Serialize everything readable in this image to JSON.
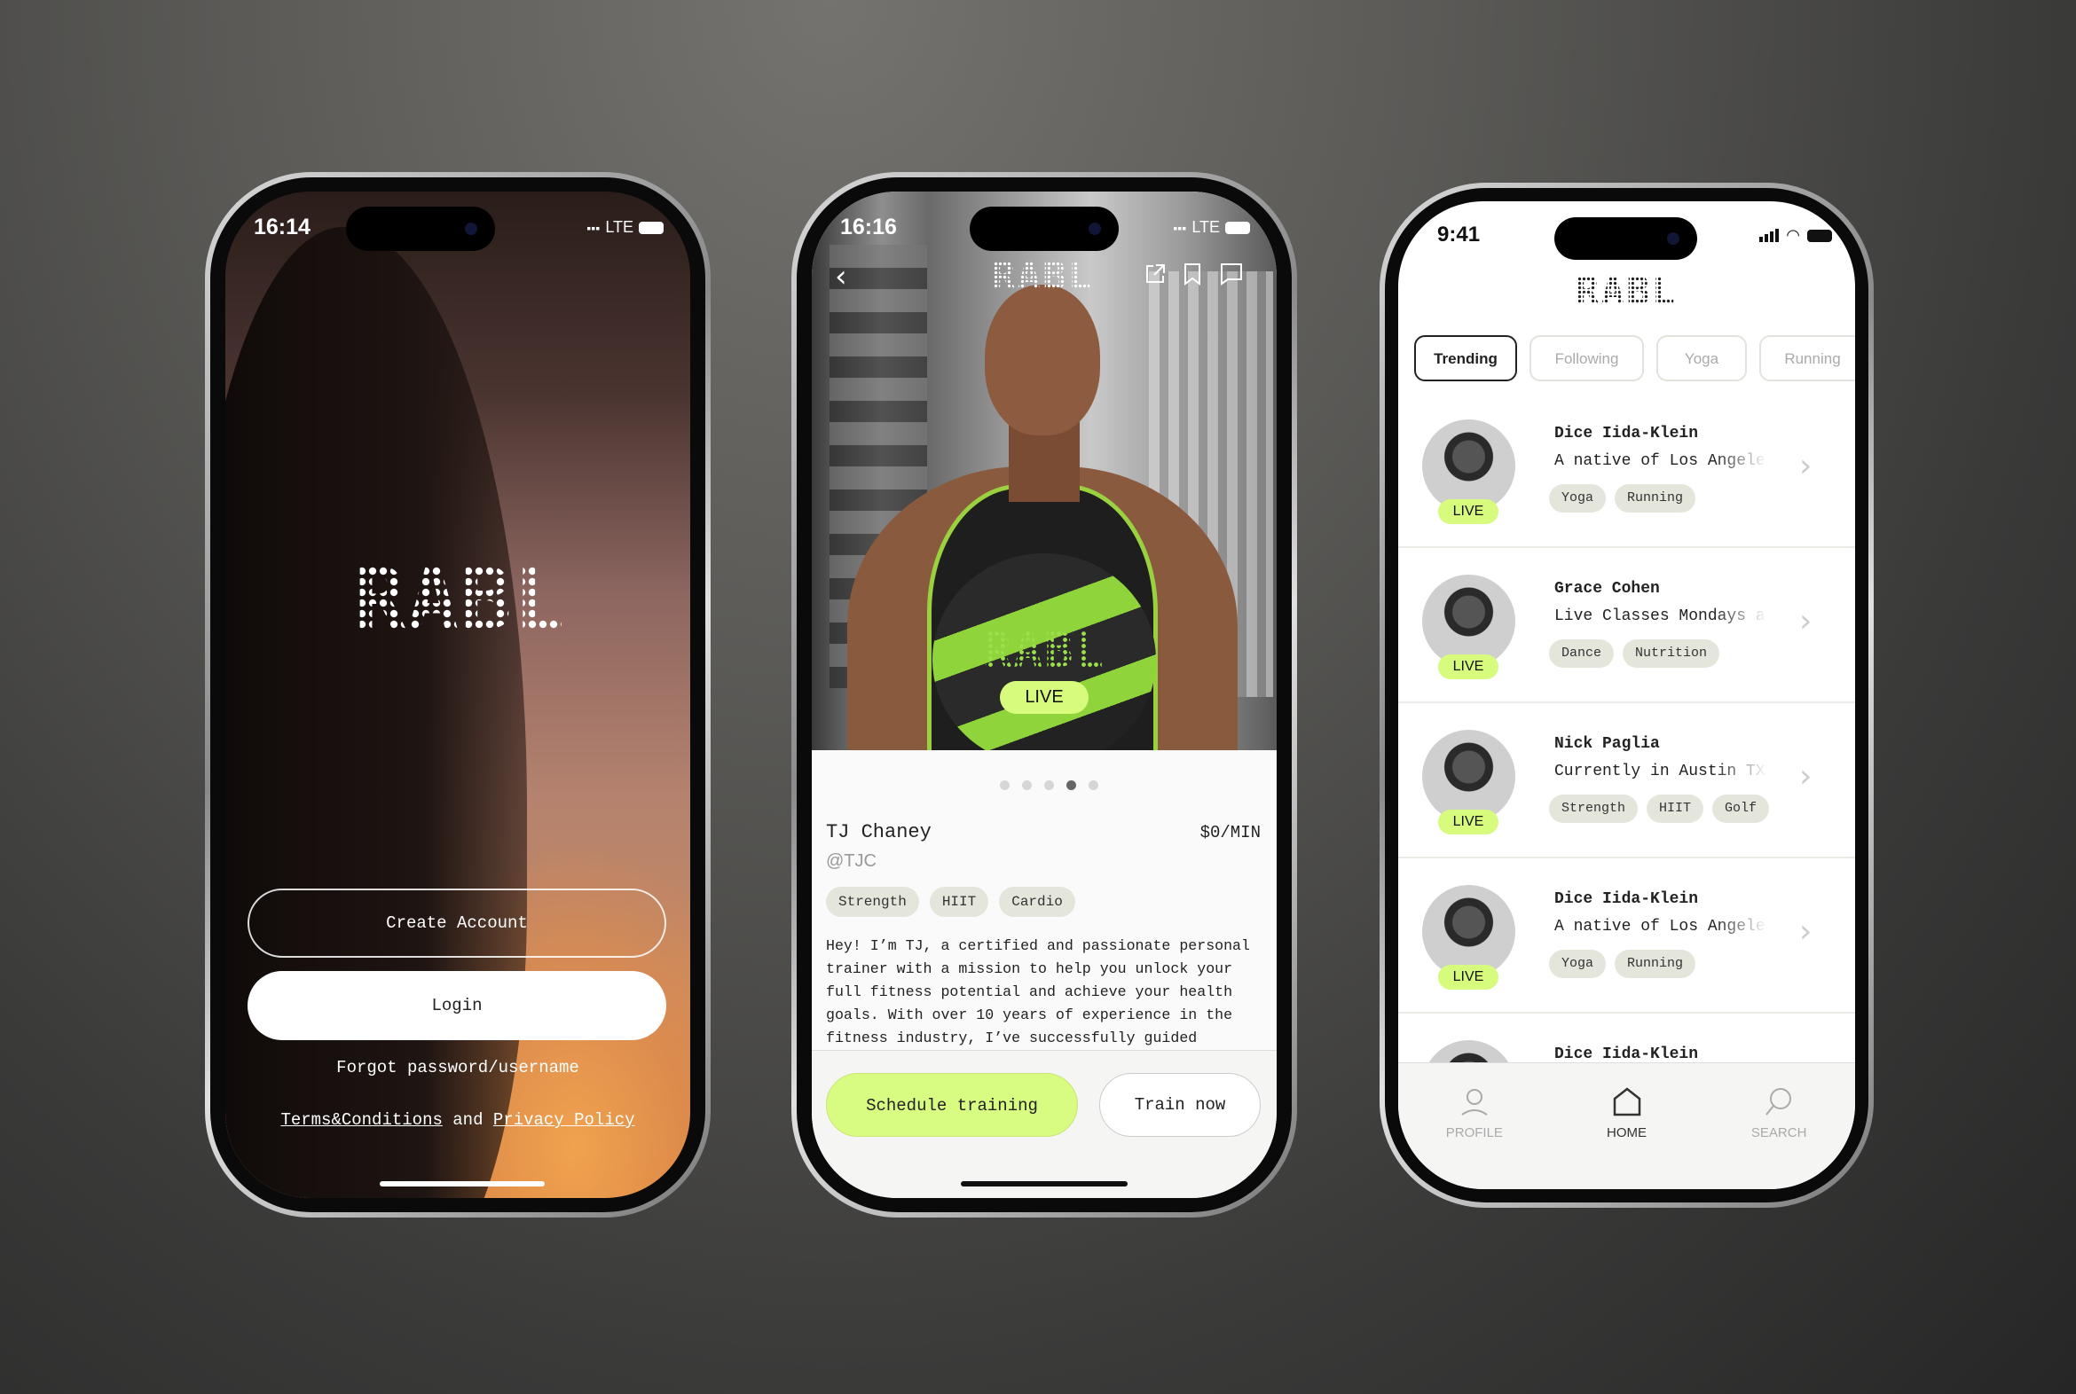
{
  "brand": {
    "logo_text": "RABL",
    "accent": "#d6fb7d",
    "tag_bg": "#e4e6dc"
  },
  "login_screen": {
    "status": {
      "time": "16:14",
      "network": "LTE"
    },
    "logo": "RABL",
    "create_account": "Create Account",
    "login": "Login",
    "forgot": "Forgot password/username",
    "terms": "Terms&Conditions",
    "and": "and",
    "privacy": "Privacy Policy"
  },
  "profile_screen": {
    "status": {
      "time": "16:16",
      "network": "LTE"
    },
    "logo": "RABL",
    "ball_logo": "RABL",
    "live": "LIVE",
    "carousel": {
      "count": 5,
      "active_index": 3
    },
    "name": "TJ Chaney",
    "price": "$0/MIN",
    "handle": "@TJC",
    "tags": [
      "Strength",
      "HIIT",
      "Cardio"
    ],
    "bio": "Hey! I’m TJ, a certified and passionate personal trainer with a mission to help you unlock your full fitness potential and achieve your health goals. With over 10 years of experience in the fitness industry, I’ve successfully guided",
    "schedule": "Schedule training",
    "train_now": "Train now",
    "icons": [
      "back-chevron-icon",
      "share-icon",
      "bookmark-icon",
      "message-icon"
    ]
  },
  "feed_screen": {
    "status": {
      "time": "9:41"
    },
    "logo": "RABL",
    "tabs": [
      {
        "label": "Trending",
        "active": true
      },
      {
        "label": "Following"
      },
      {
        "label": "Yoga"
      },
      {
        "label": "Running"
      }
    ],
    "trainers": [
      {
        "name": "Dice Iida-Klein",
        "desc": "A native of Los Angeles,",
        "tags": [
          "Yoga",
          "Running"
        ],
        "live": "LIVE"
      },
      {
        "name": "Grace Cohen",
        "desc": "Live Classes Mondays at",
        "tags": [
          "Dance",
          "Nutrition"
        ],
        "live": "LIVE"
      },
      {
        "name": "Nick Paglia",
        "desc": "Currently in Austin TX, I",
        "tags": [
          "Strength",
          "HIIT",
          "Golf"
        ],
        "live": "LIVE"
      },
      {
        "name": "Dice Iida-Klein",
        "desc": "A native of Los Angeles,",
        "tags": [
          "Yoga",
          "Running"
        ],
        "live": "LIVE"
      },
      {
        "name": "Dice Iida-Klein"
      }
    ],
    "nav": [
      {
        "label": "PROFILE",
        "icon": "person-icon"
      },
      {
        "label": "HOME",
        "icon": "home-icon",
        "active": true
      },
      {
        "label": "SEARCH",
        "icon": "search-icon"
      }
    ]
  }
}
